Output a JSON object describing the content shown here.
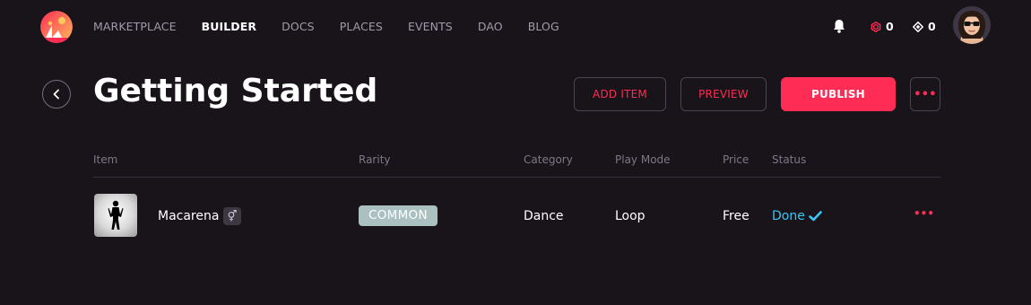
{
  "nav": {
    "items": [
      {
        "label": "MARKETPLACE",
        "active": false
      },
      {
        "label": "BUILDER",
        "active": true
      },
      {
        "label": "DOCS",
        "active": false
      },
      {
        "label": "PLACES",
        "active": false
      },
      {
        "label": "EVENTS",
        "active": false
      },
      {
        "label": "DAO",
        "active": false
      },
      {
        "label": "BLOG",
        "active": false
      }
    ]
  },
  "balances": {
    "mana": "0",
    "land": "0"
  },
  "page": {
    "title": "Getting Started"
  },
  "actions": {
    "add_item": "ADD ITEM",
    "preview": "PREVIEW",
    "publish": "PUBLISH",
    "more": "•••"
  },
  "table": {
    "headers": {
      "item": "Item",
      "rarity": "Rarity",
      "category": "Category",
      "play_mode": "Play Mode",
      "price": "Price",
      "status": "Status"
    },
    "rows": [
      {
        "name": "Macarena",
        "gender_icon": "⚥",
        "rarity": "COMMON",
        "category": "Dance",
        "play_mode": "Loop",
        "price": "Free",
        "status": "Done",
        "more": "•••"
      }
    ]
  },
  "colors": {
    "background": "#18141a",
    "accent": "#ff2d55",
    "status_done": "#3cc5f5",
    "rarity_common": "#abc1c1"
  },
  "icons": [
    "decentraland-logo-icon",
    "bell-icon",
    "mana-icon",
    "land-icon",
    "user-avatar",
    "back-arrow-icon",
    "emote-silhouette-icon",
    "unisex-icon",
    "check-icon",
    "more-icon"
  ]
}
